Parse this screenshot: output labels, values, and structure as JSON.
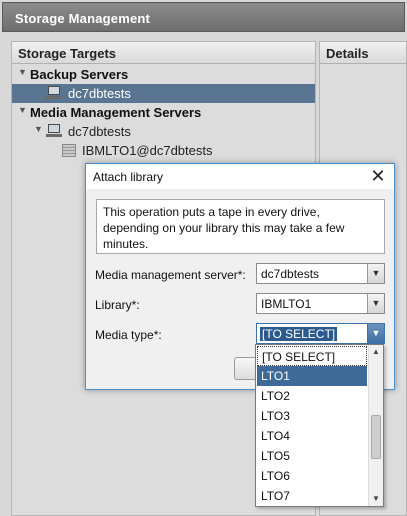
{
  "app": {
    "title": "Storage Management"
  },
  "left_panel": {
    "title": "Storage Targets",
    "groups": [
      {
        "label": "Backup Servers",
        "items": [
          {
            "label": "dc7dbtests",
            "selected": true
          }
        ]
      },
      {
        "label": "Media Management Servers",
        "items": [
          {
            "label": "dc7dbtests",
            "children": [
              {
                "label": "IBMLTO1@dc7dbtests"
              }
            ]
          }
        ]
      }
    ]
  },
  "right_panel": {
    "title": "Details"
  },
  "dialog": {
    "title": "Attach library",
    "close_glyph": "✕",
    "message": "This operation puts a tape in every drive, depending on your library this may take a few minutes.",
    "fields": {
      "mm_server": {
        "label": "Media management server*:",
        "value": "dc7dbtests"
      },
      "library": {
        "label": "Library*:",
        "value": "IBMLTO1"
      },
      "media_type": {
        "label": "Media type*:",
        "value": "[TO SELECT]"
      }
    }
  },
  "media_type_options": [
    "[TO SELECT]",
    "LTO1",
    "LTO2",
    "LTO3",
    "LTO4",
    "LTO5",
    "LTO6",
    "LTO7"
  ],
  "media_type_highlighted": "LTO1",
  "colors": {
    "selection": "#5a7592",
    "dropdown_highlight": "#3d6a96",
    "dialog_border": "#4a90d0"
  }
}
